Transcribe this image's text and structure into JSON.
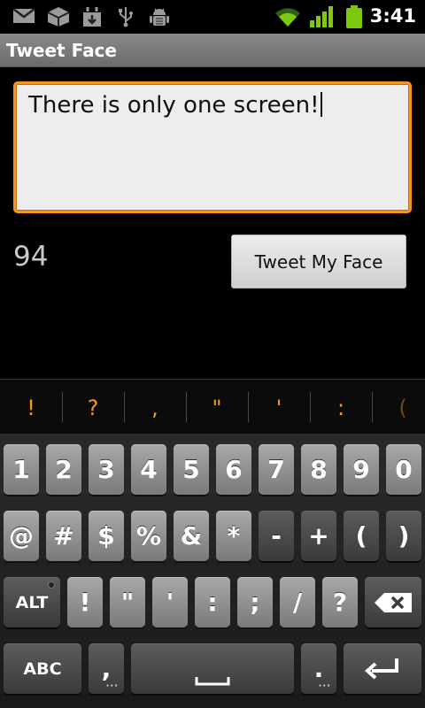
{
  "status_bar": {
    "time": "3:41",
    "icons": [
      "gmail-icon",
      "box-icon",
      "download-icon",
      "usb-icon",
      "android-debug-icon",
      "wifi-icon",
      "signal-icon",
      "battery-icon"
    ],
    "colors": {
      "signal": "#7dc90f",
      "battery": "#7dc90f"
    }
  },
  "app": {
    "title": "Tweet Face"
  },
  "compose": {
    "text": "There is only one screen!",
    "remaining_count": "94",
    "accent": "#f7931e"
  },
  "actions": {
    "tweet_label": "Tweet My Face"
  },
  "suggestions": [
    "!",
    "?",
    ",",
    "\"",
    "'",
    ":",
    "("
  ],
  "keyboard": {
    "row1": [
      "1",
      "2",
      "3",
      "4",
      "5",
      "6",
      "7",
      "8",
      "9",
      "0"
    ],
    "row2": [
      "@",
      "#",
      "$",
      "%",
      "&",
      "*",
      "-",
      "+",
      "(",
      ")"
    ],
    "row3": {
      "alt": "ALT",
      "keys": [
        "!",
        "\"",
        "'",
        ":",
        ";",
        "/",
        "?"
      ]
    },
    "row4": {
      "abc": "ABC",
      "comma": ",",
      "period": "."
    }
  }
}
